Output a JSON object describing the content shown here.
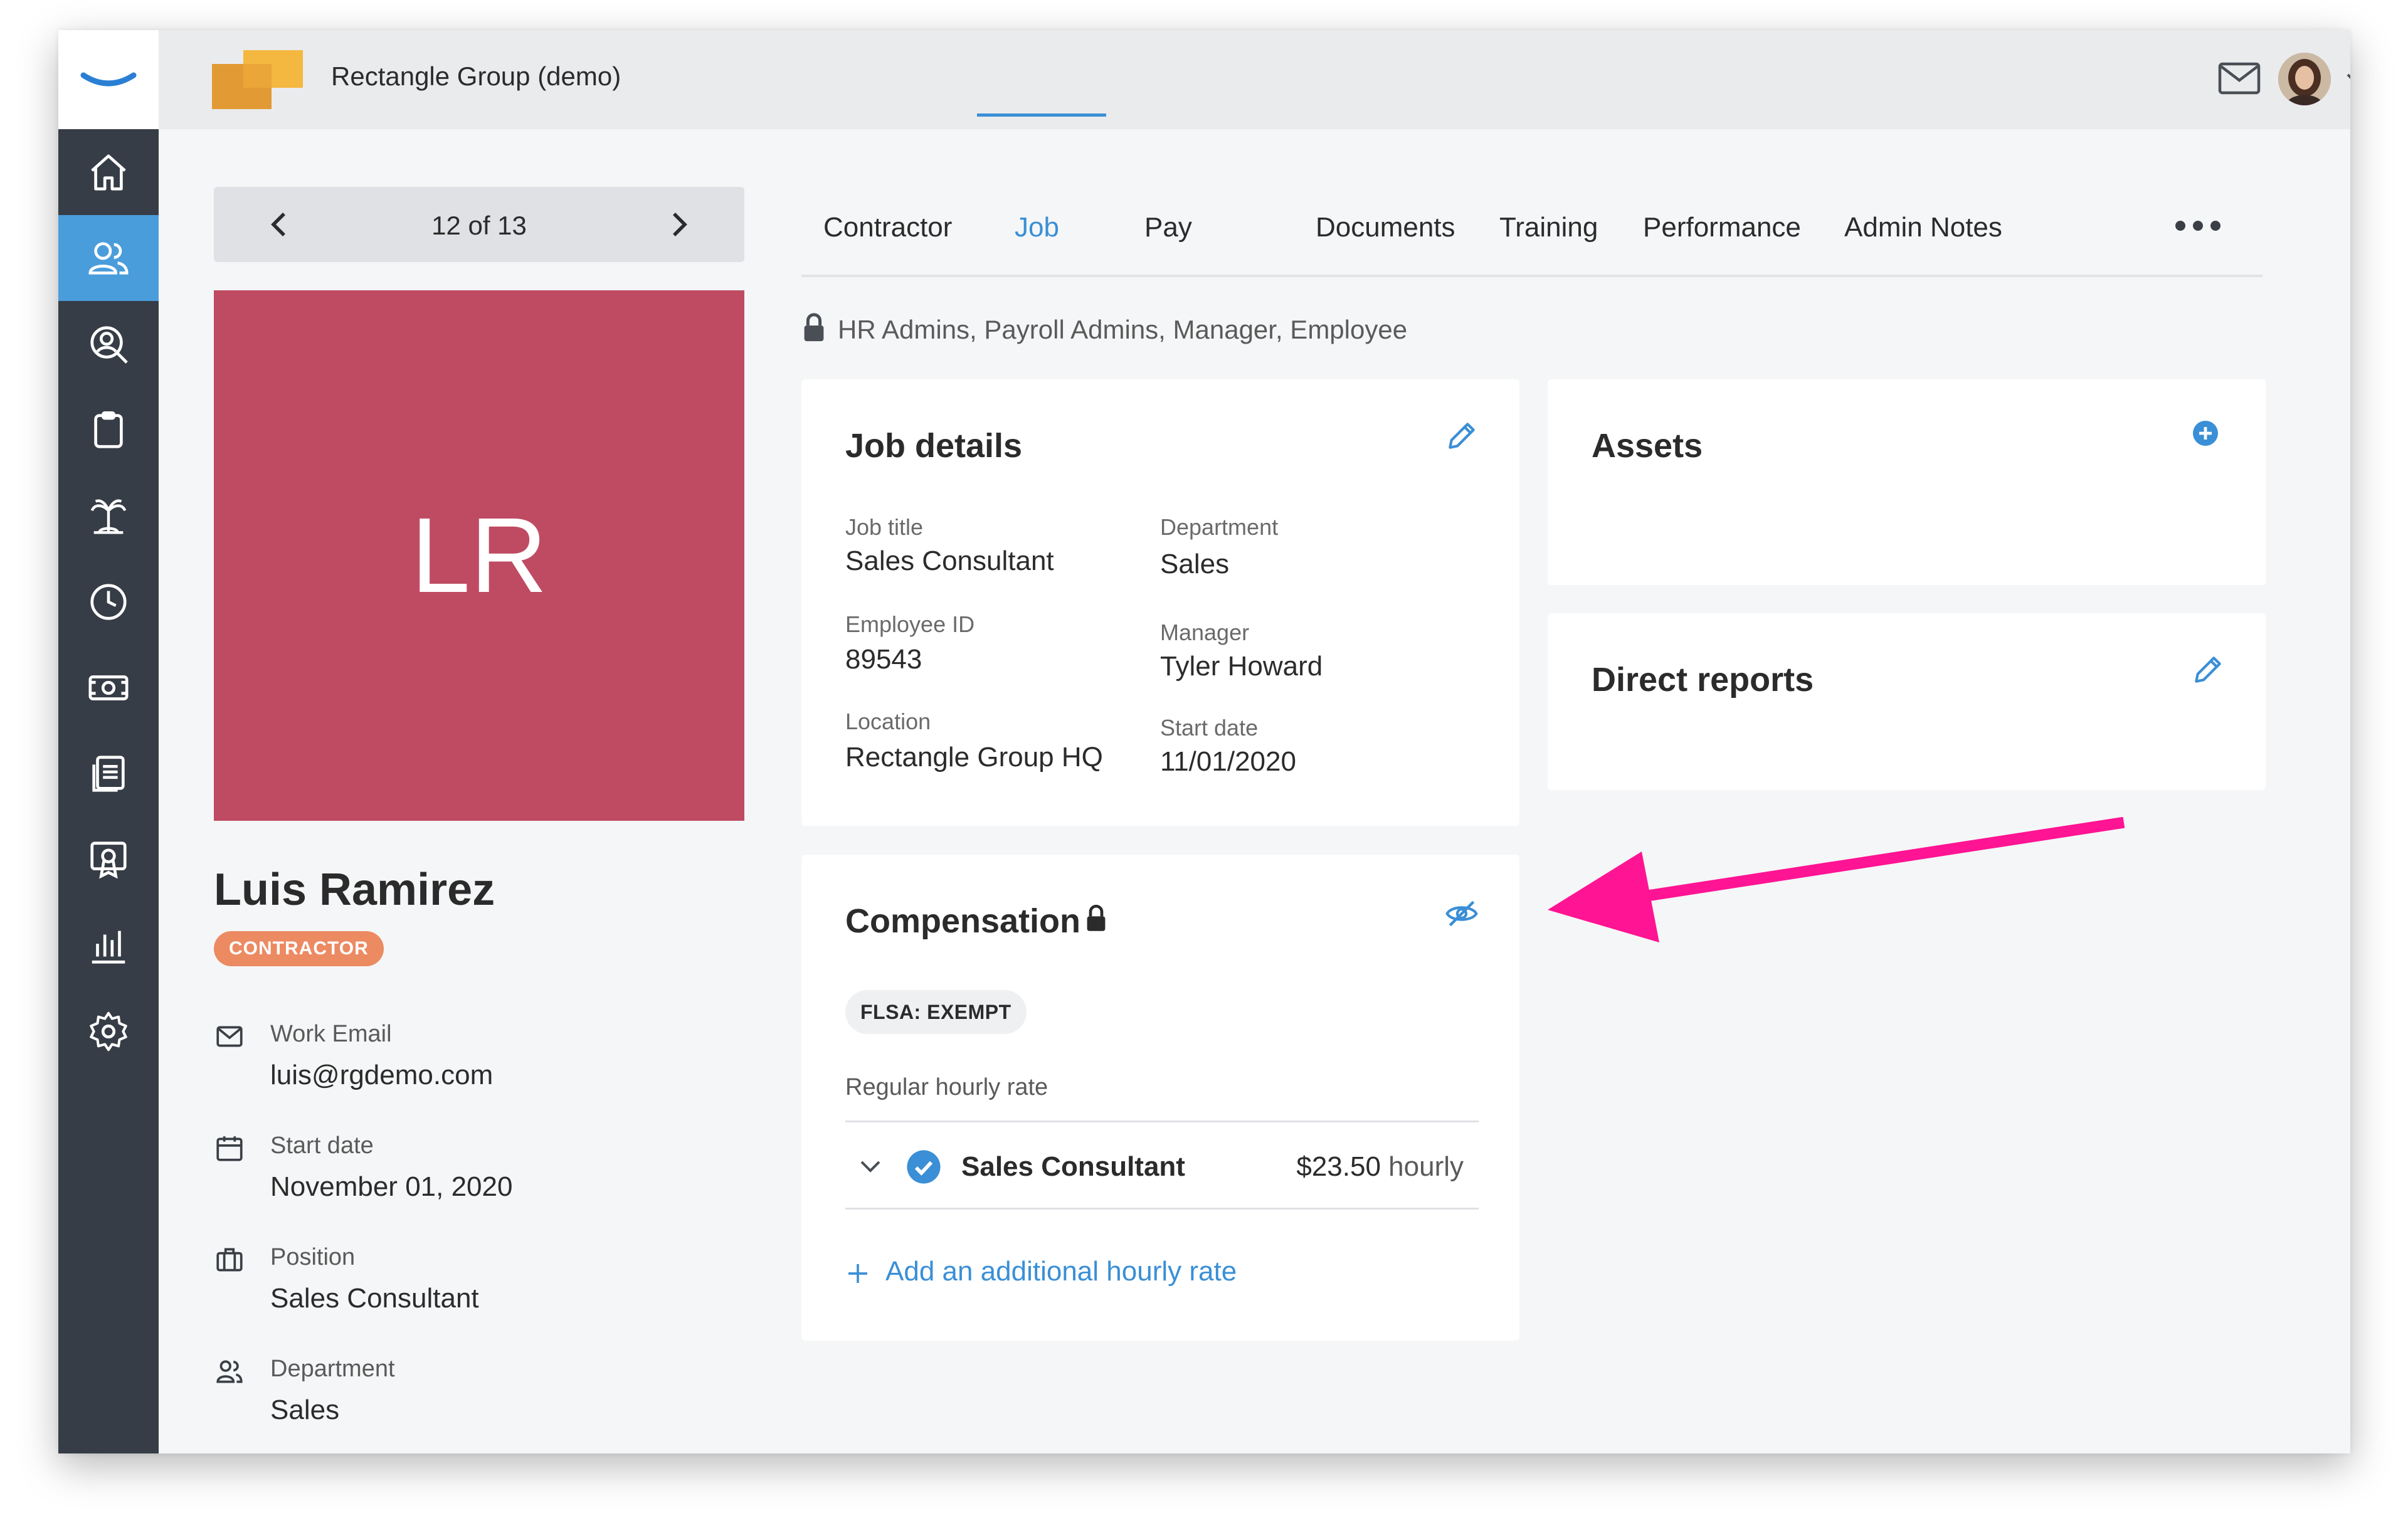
{
  "app": {
    "company_name": "Rectangle Group (demo)",
    "brand_color": "#3a8fd6",
    "sidebar_active_color": "#4a9ddb"
  },
  "sidebar": {
    "items": [
      {
        "icon": "home-icon"
      },
      {
        "icon": "people-icon",
        "active": true
      },
      {
        "icon": "recruiting-icon"
      },
      {
        "icon": "clipboard-icon"
      },
      {
        "icon": "time-off-icon"
      },
      {
        "icon": "clock-icon"
      },
      {
        "icon": "payroll-icon"
      },
      {
        "icon": "documents-icon"
      },
      {
        "icon": "training-icon"
      },
      {
        "icon": "reports-icon"
      },
      {
        "icon": "settings-icon"
      }
    ]
  },
  "pager": {
    "label": "12 of 13"
  },
  "profile": {
    "initials": "LR",
    "photo_color": "#bf4b63",
    "name": "Luis Ramirez",
    "badge": "CONTRACTOR",
    "badge_color": "#ec8a62",
    "fields": [
      {
        "icon": "mail-icon",
        "label": "Work Email",
        "value": "luis@rgdemo.com"
      },
      {
        "icon": "calendar-icon",
        "label": "Start date",
        "value": "November 01, 2020"
      },
      {
        "icon": "briefcase-icon",
        "label": "Position",
        "value": "Sales Consultant"
      },
      {
        "icon": "department-icon",
        "label": "Department",
        "value": "Sales"
      }
    ]
  },
  "tabs": [
    {
      "label": "Contractor"
    },
    {
      "label": "Job",
      "active": true
    },
    {
      "label": "Pay"
    },
    {
      "label": "Documents"
    },
    {
      "label": "Training"
    },
    {
      "label": "Performance"
    },
    {
      "label": "Admin Notes"
    }
  ],
  "access": {
    "text": "HR Admins, Payroll Admins, Manager, Employee"
  },
  "job_details": {
    "title": "Job details",
    "fields": {
      "job_title": {
        "label": "Job title",
        "value": "Sales Consultant"
      },
      "department": {
        "label": "Department",
        "value": "Sales"
      },
      "employee_id": {
        "label": "Employee ID",
        "value": "89543"
      },
      "manager": {
        "label": "Manager",
        "value": "Tyler Howard"
      },
      "location": {
        "label": "Location",
        "value": "Rectangle Group HQ"
      },
      "start_date": {
        "label": "Start date",
        "value": "11/01/2020"
      }
    }
  },
  "assets": {
    "title": "Assets"
  },
  "direct_reports": {
    "title": "Direct reports"
  },
  "compensation": {
    "title": "Compensation",
    "flsa": "FLSA: EXEMPT",
    "rate_section_label": "Regular hourly rate",
    "rate": {
      "name": "Sales Consultant",
      "amount": "$23.50",
      "unit": "hourly"
    },
    "add_rate_label": "Add an additional hourly rate"
  },
  "annotation": {
    "arrow_color": "#ff1493"
  }
}
